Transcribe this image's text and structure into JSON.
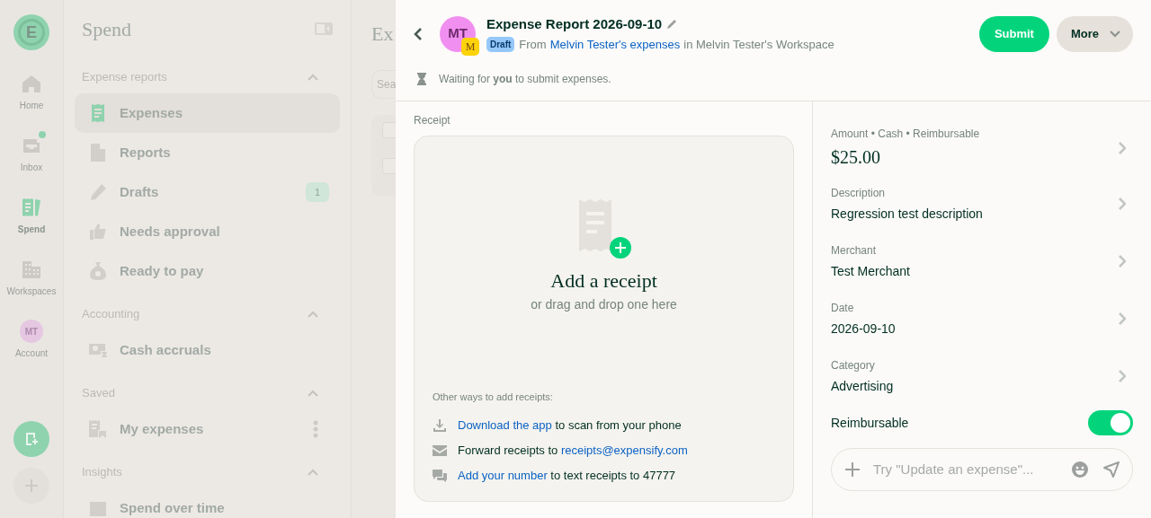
{
  "rail": {
    "logo": "E",
    "items": [
      {
        "label": "Home",
        "selected": false,
        "notification": false
      },
      {
        "label": "Inbox",
        "selected": false,
        "notification": true
      },
      {
        "label": "Spend",
        "selected": true,
        "notification": false
      },
      {
        "label": "Workspaces",
        "selected": false,
        "notification": false
      },
      {
        "label": "Account",
        "selected": false,
        "notification": false,
        "avatar": "MT"
      }
    ]
  },
  "sidebar": {
    "title": "Spend",
    "sections": [
      {
        "title": "Expense reports",
        "expanded": true,
        "items": [
          {
            "label": "Expenses",
            "selected": true
          },
          {
            "label": "Reports",
            "selected": false
          },
          {
            "label": "Drafts",
            "selected": false,
            "badge": "1"
          },
          {
            "label": "Needs approval",
            "selected": false
          },
          {
            "label": "Ready to pay",
            "selected": false
          }
        ]
      },
      {
        "title": "Accounting",
        "expanded": true,
        "items": [
          {
            "label": "Cash accruals",
            "selected": false
          }
        ]
      },
      {
        "title": "Saved",
        "expanded": true,
        "items": [
          {
            "label": "My expenses",
            "selected": false,
            "menu": true
          }
        ]
      },
      {
        "title": "Insights",
        "expanded": true,
        "items": [
          {
            "label": "Spend over time",
            "selected": false
          }
        ]
      }
    ]
  },
  "main": {
    "heading": "Ex",
    "search_placeholder": "Sea",
    "rows": [
      {
        "checked": false
      },
      {
        "checked": false
      }
    ]
  },
  "report": {
    "avatar": "MT",
    "workspace_avatar": "M",
    "title": "Expense Report 2026-09-10",
    "status": "Draft",
    "from_prefix": "From",
    "from_link": "Melvin Tester's expenses",
    "from_suffix": "in Melvin Tester's Workspace",
    "buttons": [
      "Submit",
      "More"
    ],
    "waiting": "Waiting for **you** to submit expenses."
  },
  "receipt": {
    "label": "Receipt",
    "title": "Add a receipt",
    "subtitle": "or drag and drop one here",
    "other_ways_title": "Other ways to add receipts:",
    "options": [
      {
        "link": "Download the app",
        "after": " to scan from your phone"
      },
      {
        "before": "Forward receipts to ",
        "link": "receipts@expensify.com"
      },
      {
        "link": "Add your number",
        "after": " to text receipts to 47777"
      }
    ]
  },
  "details": {
    "fields": [
      {
        "kind": "amount",
        "label": "Amount • Cash • Reimbursable",
        "value": "$25.00"
      },
      {
        "kind": "text",
        "label": "Description",
        "value": "Regression test description"
      },
      {
        "kind": "text",
        "label": "Merchant",
        "value": "Test Merchant"
      },
      {
        "kind": "text",
        "label": "Date",
        "value": "2026-09-10"
      },
      {
        "kind": "text",
        "label": "Category",
        "value": "Advertising"
      }
    ],
    "toggle": {
      "label": "Reimbursable",
      "on": true
    },
    "composer_placeholder": "Try \"Update an expense\"..."
  }
}
